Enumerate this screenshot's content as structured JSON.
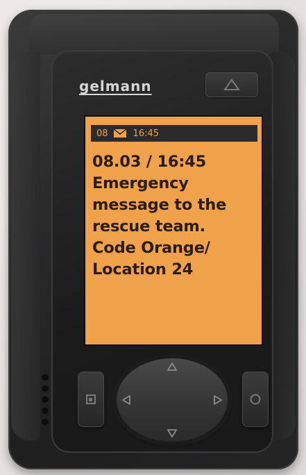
{
  "device": {
    "brand": "gelmann",
    "colors": {
      "screen_background": "#f0a24a",
      "screen_text": "#2a1c10",
      "status_bar_background": "#2b2b2b",
      "body": "#2a2a2b"
    }
  },
  "screen": {
    "status_bar": {
      "count": "08",
      "icon": "envelope-icon",
      "time": "16:45"
    },
    "message_lines": [
      "08.03 / 16:45",
      "Emergency",
      "message to the",
      "rescue team.",
      "Code Orange/",
      "Location 24"
    ]
  },
  "controls": {
    "top_button_icon": "triangle-up-icon",
    "left_button_icon": "square-icon",
    "right_button_icon": "circle-icon",
    "dpad_icons": [
      "arrow-up-icon",
      "arrow-down-icon",
      "arrow-left-icon",
      "arrow-right-icon"
    ]
  }
}
